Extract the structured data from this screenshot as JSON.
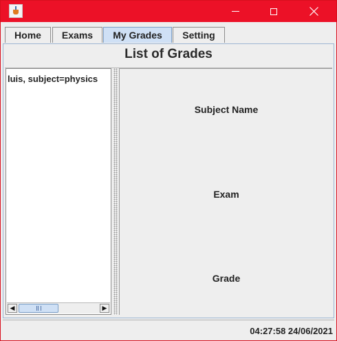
{
  "window": {
    "icon": "java-cup-icon",
    "controls": {
      "minimize": "minimize-icon",
      "maximize": "maximize-icon",
      "close": "close-icon"
    },
    "title_bar_color": "#ec1127"
  },
  "tabs": [
    {
      "label": "Home",
      "selected": false
    },
    {
      "label": "Exams",
      "selected": false
    },
    {
      "label": "My Grades",
      "selected": true
    },
    {
      "label": "Setting",
      "selected": false
    }
  ],
  "main": {
    "title": "List of  Grades",
    "list_items": [
      "luis, subject=physics"
    ],
    "detail": {
      "subject_label": "Subject Name",
      "exam_label": "Exam",
      "grade_label": "Grade"
    }
  },
  "status": {
    "timestamp": "04:27:58 24/06/2021"
  },
  "colors": {
    "selected_tab": "#cfe0f5",
    "accent_border": "#9db5d2"
  }
}
